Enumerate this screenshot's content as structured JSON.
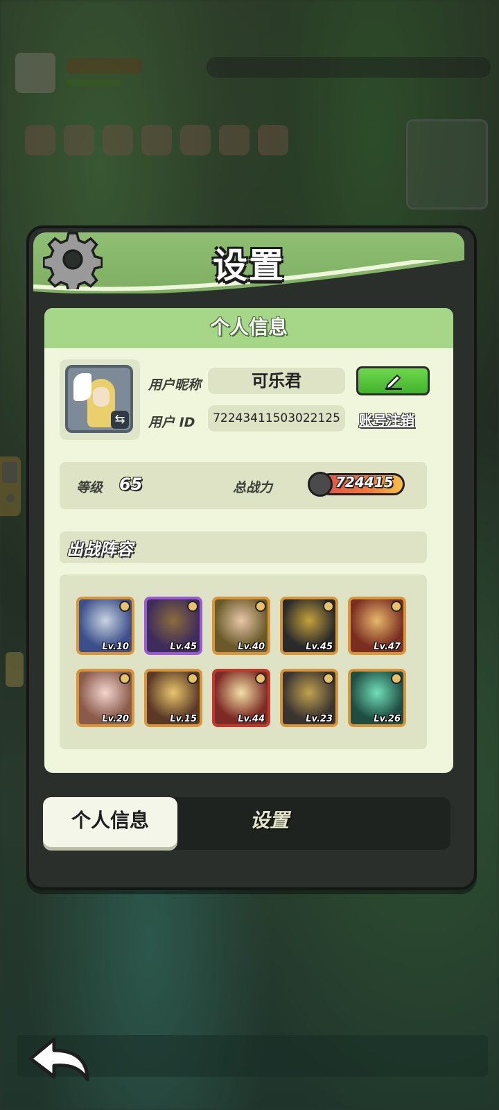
{
  "modal": {
    "title": "设置",
    "section_title": "个人信息",
    "profile": {
      "nickname_label": "用户昵称",
      "nickname": "可乐君",
      "id_label": "用户 ID",
      "user_id": "72243411503022125",
      "cancel_account": "账号注销",
      "edit_icon": "pencil-icon",
      "swap_icon": "swap-icon",
      "swap_glyph": "⇆"
    },
    "stats": {
      "level_label": "等级",
      "level": "65",
      "power_label": "总战力",
      "power": "724415"
    },
    "lineup": {
      "title": "出战阵容",
      "heroes": [
        {
          "lv": "Lv.10",
          "frame": "#d8953a",
          "c1": "#3b4f8a",
          "c2": "#c9d3e2"
        },
        {
          "lv": "Lv.45",
          "frame": "#9b59d6",
          "c1": "#3e2c5a",
          "c2": "#8c6c3a"
        },
        {
          "lv": "Lv.40",
          "frame": "#d8953a",
          "c1": "#6a5a2a",
          "c2": "#e8c7a8"
        },
        {
          "lv": "Lv.45",
          "frame": "#d8953a",
          "c1": "#2a2a2a",
          "c2": "#c5a23c"
        },
        {
          "lv": "Lv.47",
          "frame": "#d8953a",
          "c1": "#7a2e22",
          "c2": "#e8b86a"
        },
        {
          "lv": "Lv.20",
          "frame": "#d8953a",
          "c1": "#8a5a4a",
          "c2": "#f2d6d0"
        },
        {
          "lv": "Lv.15",
          "frame": "#d8953a",
          "c1": "#5a3a26",
          "c2": "#e9c56c"
        },
        {
          "lv": "Lv.44",
          "frame": "#c0392b",
          "c1": "#7d2a24",
          "c2": "#f1e1a6"
        },
        {
          "lv": "Lv.23",
          "frame": "#d8953a",
          "c1": "#3a3430",
          "c2": "#c2a14e"
        },
        {
          "lv": "Lv.26",
          "frame": "#d8953a",
          "c1": "#1f4d42",
          "c2": "#6fe0b8"
        }
      ]
    },
    "tabs": [
      {
        "label": "个人信息",
        "active": true
      },
      {
        "label": "设置",
        "active": false
      }
    ]
  },
  "icons": {
    "settings": "gear-icon",
    "back": "back-arrow-icon",
    "power": "swords-icon"
  },
  "colors": {
    "header_green": "#8fbf72",
    "section_green": "#a6d789",
    "panel_bg": "#f0f6dc",
    "edit_button": "#42b22d"
  }
}
